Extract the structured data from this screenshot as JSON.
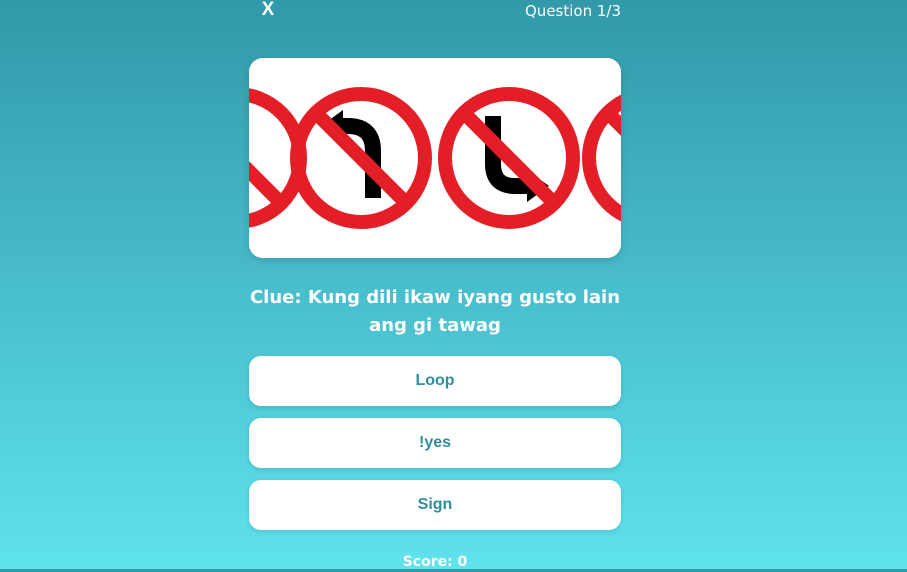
{
  "header": {
    "close_label": "X",
    "progress": "Question 1/3"
  },
  "question": {
    "image_icon": "no-left-turn-no-right-turn-signs",
    "clue": "Clue: Kung dili ikaw iyang gusto lain ang gi tawag"
  },
  "options": [
    {
      "label": "Loop"
    },
    {
      "label": "!yes"
    },
    {
      "label": "Sign"
    }
  ],
  "footer": {
    "score": "Score: 0"
  },
  "colors": {
    "background_top": "#3199a8",
    "background_bottom": "#5fe3ee",
    "option_text": "#2f8e9c",
    "sign_red": "#e41e26"
  }
}
